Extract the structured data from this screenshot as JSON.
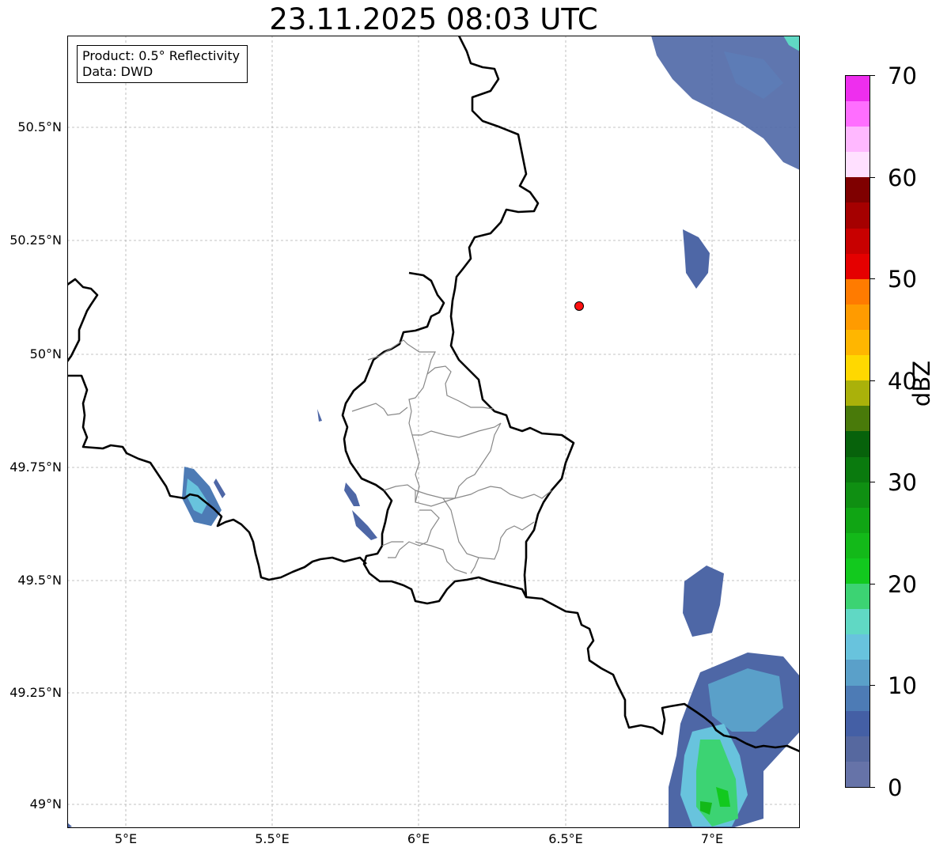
{
  "title": "23.11.2025 08:03 UTC",
  "info": {
    "product_line": "Product: 0.5° Reflectivity",
    "data_line": "Data: DWD"
  },
  "map": {
    "lat_range": [
      48.95,
      50.72
    ],
    "lon_range": [
      4.8,
      7.3
    ],
    "gridlines": true,
    "lat_ticks": [
      "50.5°N",
      "50.25°N",
      "50°N",
      "49.75°N",
      "49.5°N",
      "49.25°N",
      "49°N"
    ],
    "lon_ticks": [
      "5°E",
      "5.5°E",
      "6°E",
      "6.5°E",
      "7°E"
    ],
    "marker": {
      "lat": 50.11,
      "lon": 6.55,
      "color": "#ff1010"
    }
  },
  "colorbar": {
    "label": "dBZ",
    "min": 0,
    "max": 70,
    "tick_labels": [
      "0",
      "10",
      "20",
      "30",
      "40",
      "50",
      "60",
      "70"
    ],
    "colors": [
      "#6673a8",
      "#56689f",
      "#445fa5",
      "#4d7bb5",
      "#5aa0c9",
      "#68c3dd",
      "#60d8c4",
      "#3cd373",
      "#12c91e",
      "#13b919",
      "#10a514",
      "#0f8f12",
      "#0a7a0e",
      "#07620b",
      "#497a0a",
      "#aab10a",
      "#ffd800",
      "#ffb600",
      "#ff9b00",
      "#ff7b00",
      "#e50000",
      "#c80000",
      "#a50000",
      "#7f0000",
      "#ffe0ff",
      "#ffb8ff",
      "#ff6eff",
      "#ee2eee"
    ]
  }
}
